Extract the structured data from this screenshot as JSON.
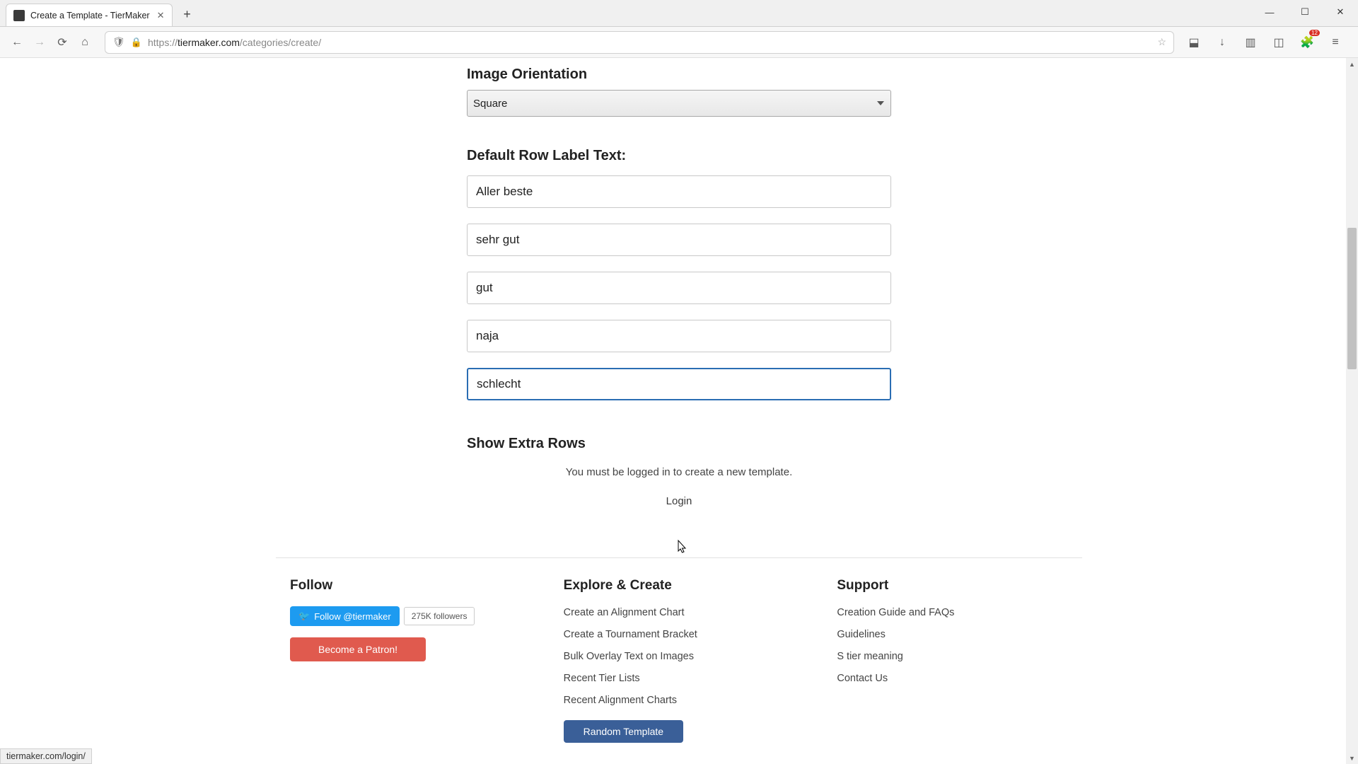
{
  "browser": {
    "tab_title": "Create a Template - TierMaker",
    "url_scheme": "https://",
    "url_host": "tiermaker.com",
    "url_path": "/categories/create/",
    "status_bar": "tiermaker.com/login/"
  },
  "form": {
    "orientation_label": "Image Orientation",
    "orientation_value": "Square",
    "row_labels_header": "Default Row Label Text:",
    "rows": [
      "Aller beste",
      "sehr gut",
      "gut",
      "naja",
      "schlecht"
    ],
    "extra_rows_header": "Show Extra Rows",
    "login_required_msg": "You must be logged in to create a new template.",
    "login_link": "Login"
  },
  "footer": {
    "follow": {
      "heading": "Follow",
      "twitter_label": "Follow @tiermaker",
      "twitter_followers": "275K followers",
      "patron_label": "Become a Patron!"
    },
    "explore": {
      "heading": "Explore & Create",
      "links": [
        "Create an Alignment Chart",
        "Create a Tournament Bracket",
        "Bulk Overlay Text on Images",
        "Recent Tier Lists",
        "Recent Alignment Charts"
      ],
      "random_btn": "Random Template"
    },
    "support": {
      "heading": "Support",
      "links": [
        "Creation Guide and FAQs",
        "Guidelines",
        "S tier meaning",
        "Contact Us"
      ]
    }
  }
}
